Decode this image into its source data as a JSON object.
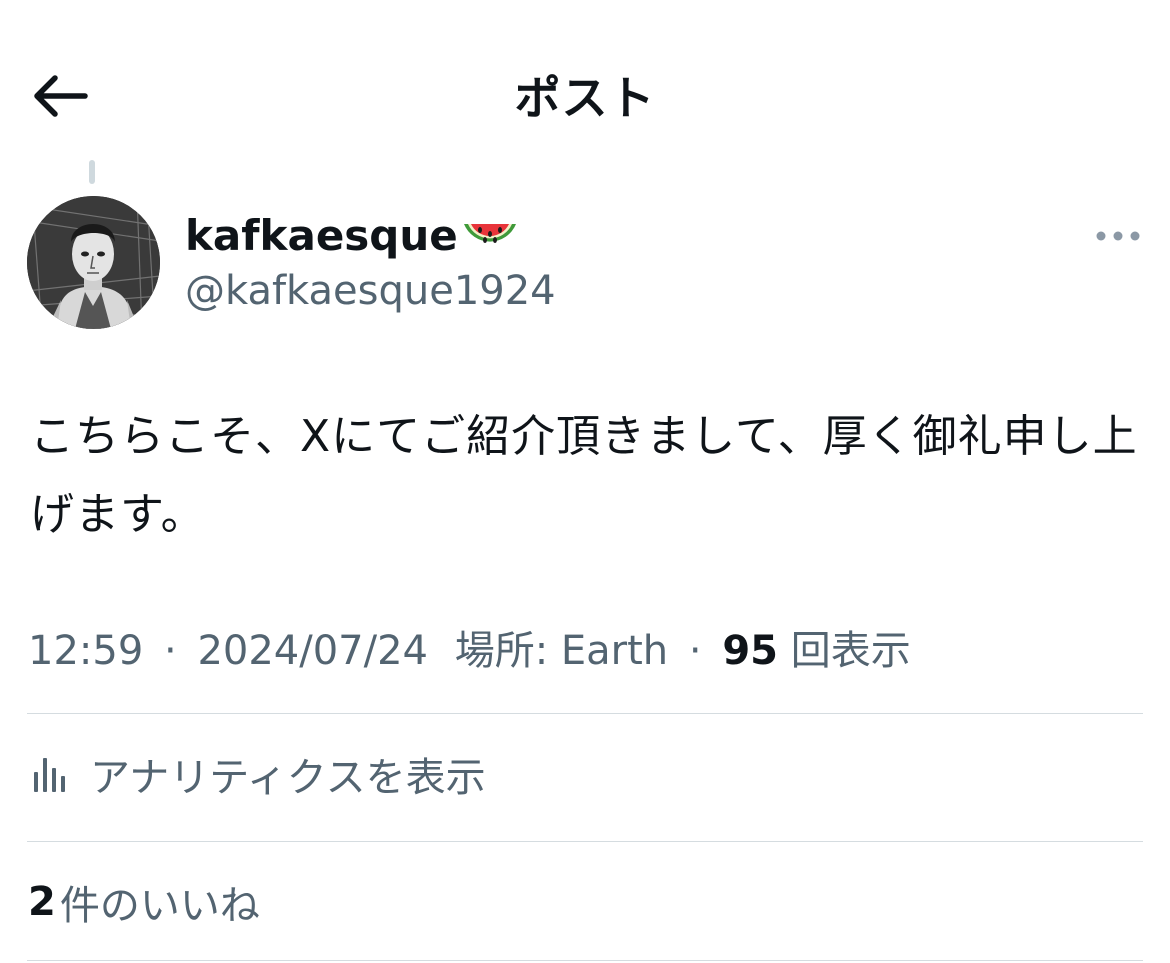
{
  "header": {
    "title": "ポスト",
    "back_icon": "arrow-left-icon"
  },
  "author": {
    "display_name": "kafkaesque",
    "name_emoji": "watermelon",
    "handle": "@kafkaesque1924"
  },
  "post": {
    "text": "こちらこそ、Xにてご紹介頂きまして、厚く御礼申し上げます。"
  },
  "meta": {
    "time": "12:59",
    "separator": "·",
    "date": "2024/07/24",
    "location_label": "場所: Earth",
    "views_count": "95",
    "views_label": "回表示"
  },
  "analytics": {
    "label": "アナリティクスを表示",
    "icon": "analytics-bar-chart-icon"
  },
  "likes": {
    "count": "2",
    "label": "件のいいね"
  },
  "colors": {
    "text_primary": "#0f1419",
    "text_secondary": "#536471",
    "divider": "#d5dce0",
    "thread_line": "#cfd9de"
  }
}
